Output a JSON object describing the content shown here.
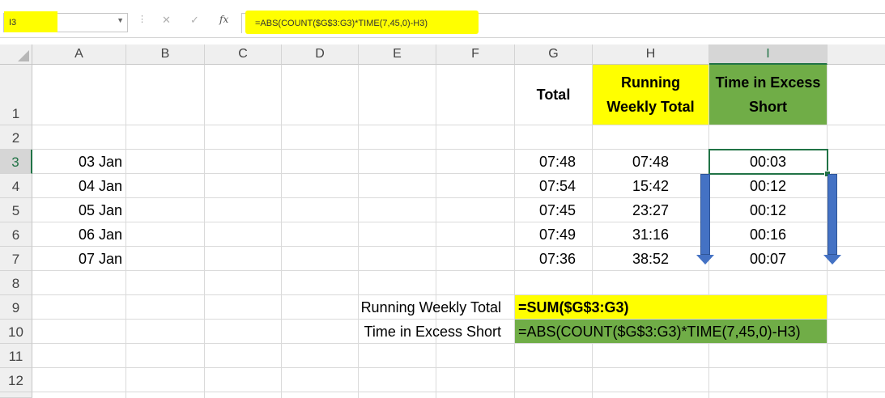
{
  "formula_bar": {
    "name_box": "I3",
    "cancel_icon": "✕",
    "enter_icon": "✓",
    "fx_label": "fx",
    "formula": "=ABS(COUNT($G$3:G3)*TIME(7,45,0)-H3)"
  },
  "columns": [
    "A",
    "B",
    "C",
    "D",
    "E",
    "F",
    "G",
    "H",
    "I"
  ],
  "rows": [
    "1",
    "2",
    "3",
    "4",
    "5",
    "6",
    "7",
    "8",
    "9",
    "10",
    "11",
    "12"
  ],
  "headers": {
    "total": "Total",
    "running_line1": "Running",
    "running_line2": "Weekly Total",
    "excess_line1": "Time in Excess",
    "excess_line2": "Short"
  },
  "table": [
    {
      "date": "03 Jan",
      "total": "07:48",
      "running": "07:48",
      "excess": "00:03"
    },
    {
      "date": "04 Jan",
      "total": "07:54",
      "running": "15:42",
      "excess": "00:12"
    },
    {
      "date": "05 Jan",
      "total": "07:45",
      "running": "23:27",
      "excess": "00:12"
    },
    {
      "date": "06 Jan",
      "total": "07:49",
      "running": "31:16",
      "excess": "00:16"
    },
    {
      "date": "07 Jan",
      "total": "07:36",
      "running": "38:52",
      "excess": "00:07"
    }
  ],
  "notes": {
    "running_label": "Running Weekly Total",
    "running_formula": "=SUM($G$3:G3)",
    "excess_label": "Time in Excess Short",
    "excess_formula": "=ABS(COUNT($G$3:G3)*TIME(7,45,0)-H3)"
  },
  "colors": {
    "highlight_yellow": "#ffff00",
    "highlight_green": "#70ad47",
    "selection_green": "#217346",
    "arrow_blue": "#4472c4"
  }
}
